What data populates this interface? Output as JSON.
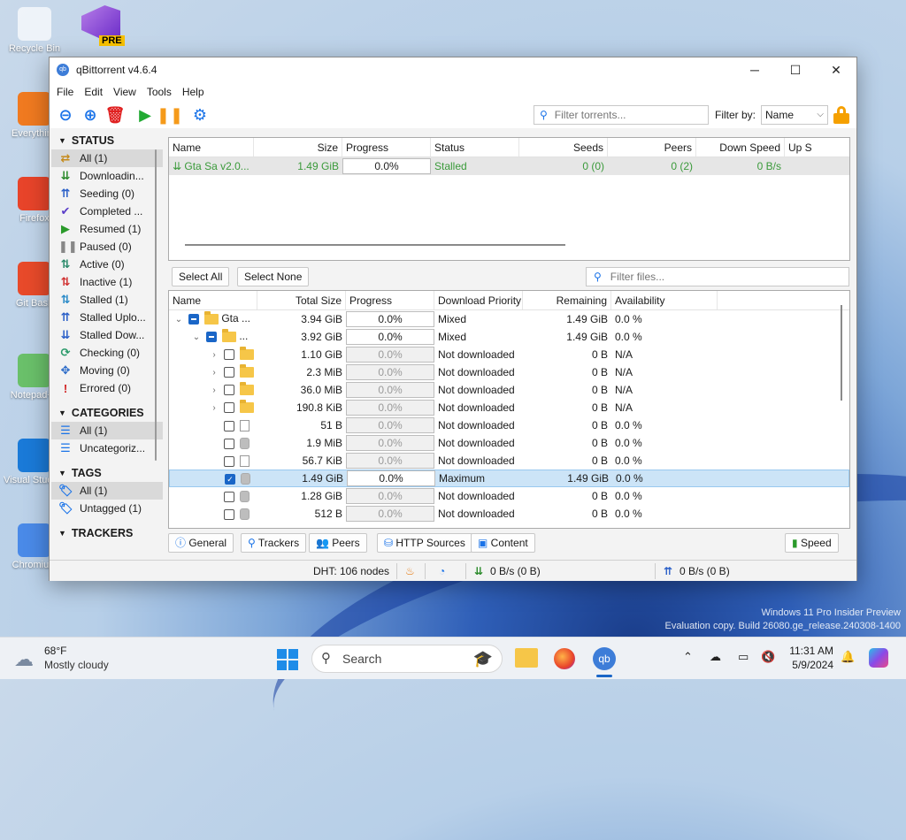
{
  "desktop": {
    "icons": [
      "Recycle Bin",
      "Everything",
      "Firefox",
      "Git Bash",
      "Notepad++",
      "Visual Studio Code",
      "Chromium"
    ],
    "vs_badge": "PRE",
    "watermark_line1": "Windows 11 Pro Insider Preview",
    "watermark_line2": "Evaluation copy. Build 26080.ge_release.240308-1400"
  },
  "window": {
    "title": "qBittorrent v4.6.4",
    "app_icon_text": "qb",
    "minimize": "─",
    "maximize": "☐",
    "close": "✕"
  },
  "menu": [
    "File",
    "Edit",
    "View",
    "Tools",
    "Help"
  ],
  "toolbar": {
    "filter_placeholder": "Filter torrents...",
    "filter_by_label": "Filter by:",
    "filter_by_value": "Name"
  },
  "sidebar": {
    "status_header": "STATUS",
    "status": [
      {
        "label": "All (1)",
        "icon": "⇄",
        "color": "#c58a1a"
      },
      {
        "label": "Downloadin...",
        "icon": "⇊",
        "color": "#2a8a2a"
      },
      {
        "label": "Seeding (0)",
        "icon": "⇈",
        "color": "#2a5fc8"
      },
      {
        "label": "Completed ...",
        "icon": "✔",
        "color": "#5a3ec8"
      },
      {
        "label": "Resumed (1)",
        "icon": "▶",
        "color": "#2a9a2a"
      },
      {
        "label": "Paused (0)",
        "icon": "❚❚",
        "color": "#888888"
      },
      {
        "label": "Active (0)",
        "icon": "⇅",
        "color": "#2a8a6a"
      },
      {
        "label": "Inactive (1)",
        "icon": "⇅",
        "color": "#d03030"
      },
      {
        "label": "Stalled (1)",
        "icon": "⇅",
        "color": "#2a8ac8"
      },
      {
        "label": "Stalled Uplo...",
        "icon": "⇈",
        "color": "#2a5fc8"
      },
      {
        "label": "Stalled Dow...",
        "icon": "⇊",
        "color": "#2a5fc8"
      },
      {
        "label": "Checking (0)",
        "icon": "⟳",
        "color": "#2a9a6a"
      },
      {
        "label": "Moving (0)",
        "icon": "✥",
        "color": "#2a6ac8"
      },
      {
        "label": "Errored (0)",
        "icon": "!",
        "color": "#d02020"
      }
    ],
    "categories_header": "CATEGORIES",
    "categories": [
      {
        "label": "All (1)"
      },
      {
        "label": "Uncategoriz..."
      }
    ],
    "tags_header": "TAGS",
    "tags": [
      {
        "label": "All (1)"
      },
      {
        "label": "Untagged (1)"
      }
    ],
    "trackers_header": "TRACKERS"
  },
  "torrents": {
    "columns": [
      "Name",
      "Size",
      "Progress",
      "Status",
      "Seeds",
      "Peers",
      "Down Speed",
      "Up S"
    ],
    "rows": [
      {
        "name": "Gta Sa v2.0...",
        "size": "1.49 GiB",
        "progress": "0.0%",
        "status": "Stalled",
        "seeds": "0 (0)",
        "peers": "0 (2)",
        "down": "0 B/s"
      }
    ]
  },
  "files": {
    "select_all": "Select All",
    "select_none": "Select None",
    "filter_placeholder": "Filter files...",
    "columns": [
      "Name",
      "Total Size",
      "Progress",
      "Download Priority",
      "Remaining",
      "Availability"
    ],
    "rows": [
      {
        "depth": 0,
        "exp": "⌄",
        "cb": "part",
        "ic": "folder",
        "name": "Gta ...",
        "size": "3.94 GiB",
        "progress": "0.0%",
        "priority": "Mixed",
        "remaining": "1.49 GiB",
        "avail": "0.0 %"
      },
      {
        "depth": 1,
        "exp": "⌄",
        "cb": "part",
        "ic": "folder",
        "name": "...",
        "size": "3.92 GiB",
        "progress": "0.0%",
        "priority": "Mixed",
        "remaining": "1.49 GiB",
        "avail": "0.0 %"
      },
      {
        "depth": 2,
        "exp": "›",
        "cb": "",
        "ic": "folder",
        "name": "",
        "size": "1.10 GiB",
        "progress": "0.0%",
        "priority": "Not downloaded",
        "remaining": "0 B",
        "avail": "N/A"
      },
      {
        "depth": 2,
        "exp": "›",
        "cb": "",
        "ic": "folder",
        "name": "",
        "size": "2.3 MiB",
        "progress": "0.0%",
        "priority": "Not downloaded",
        "remaining": "0 B",
        "avail": "N/A"
      },
      {
        "depth": 2,
        "exp": "›",
        "cb": "",
        "ic": "folder",
        "name": "",
        "size": "36.0 MiB",
        "progress": "0.0%",
        "priority": "Not downloaded",
        "remaining": "0 B",
        "avail": "N/A"
      },
      {
        "depth": 2,
        "exp": "›",
        "cb": "",
        "ic": "folder",
        "name": "",
        "size": "190.8 KiB",
        "progress": "0.0%",
        "priority": "Not downloaded",
        "remaining": "0 B",
        "avail": "N/A"
      },
      {
        "depth": 2,
        "exp": "",
        "cb": "",
        "ic": "file",
        "name": "",
        "size": "51 B",
        "progress": "0.0%",
        "priority": "Not downloaded",
        "remaining": "0 B",
        "avail": "0.0 %"
      },
      {
        "depth": 2,
        "exp": "",
        "cb": "",
        "ic": "gfile",
        "name": "",
        "size": "1.9 MiB",
        "progress": "0.0%",
        "priority": "Not downloaded",
        "remaining": "0 B",
        "avail": "0.0 %"
      },
      {
        "depth": 2,
        "exp": "",
        "cb": "",
        "ic": "file",
        "name": "",
        "size": "56.7 KiB",
        "progress": "0.0%",
        "priority": "Not downloaded",
        "remaining": "0 B",
        "avail": "0.0 %"
      },
      {
        "depth": 2,
        "exp": "",
        "cb": "chk",
        "ic": "gfile",
        "name": "",
        "size": "1.49 GiB",
        "progress": "0.0%",
        "priority": "Maximum",
        "remaining": "1.49 GiB",
        "avail": "0.0 %",
        "sel": true
      },
      {
        "depth": 2,
        "exp": "",
        "cb": "",
        "ic": "gfile",
        "name": "",
        "size": "1.28 GiB",
        "progress": "0.0%",
        "priority": "Not downloaded",
        "remaining": "0 B",
        "avail": "0.0 %"
      },
      {
        "depth": 2,
        "exp": "",
        "cb": "",
        "ic": "gfile",
        "name": "",
        "size": "512 B",
        "progress": "0.0%",
        "priority": "Not downloaded",
        "remaining": "0 B",
        "avail": "0.0 %"
      }
    ]
  },
  "tabs": [
    "General",
    "Trackers",
    "Peers",
    "HTTP Sources",
    "Content"
  ],
  "speed_button": "Speed",
  "status": {
    "dht": "DHT: 106 nodes",
    "down": "0 B/s (0 B)",
    "up": "0 B/s (0 B)"
  },
  "taskbar": {
    "weather_temp": "68°F",
    "weather_desc": "Mostly cloudy",
    "search": "Search",
    "time": "11:31 AM",
    "date": "5/9/2024",
    "qb_icon_text": "qb"
  }
}
